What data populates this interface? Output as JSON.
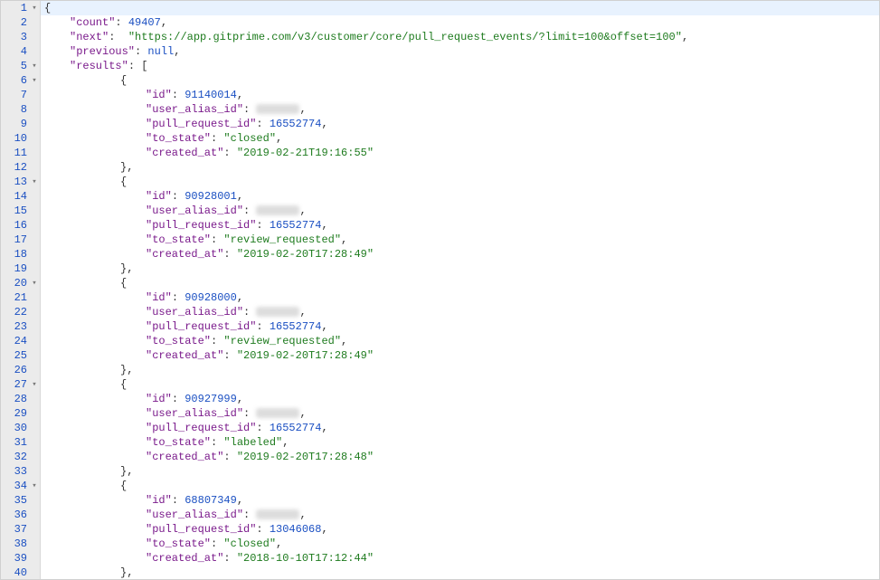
{
  "json": {
    "count": 49407,
    "next": "https://app.gitprime.com/v3/customer/core/pull_request_events/?limit=100&offset=100",
    "previous": null,
    "results": [
      {
        "id": 91140014,
        "user_alias_id": "REDACTED",
        "pull_request_id": 16552774,
        "to_state": "closed",
        "created_at": "2019-02-21T19:16:55"
      },
      {
        "id": 90928001,
        "user_alias_id": "REDACTED",
        "pull_request_id": 16552774,
        "to_state": "review_requested",
        "created_at": "2019-02-20T17:28:49"
      },
      {
        "id": 90928000,
        "user_alias_id": "REDACTED",
        "pull_request_id": 16552774,
        "to_state": "review_requested",
        "created_at": "2019-02-20T17:28:49"
      },
      {
        "id": 90927999,
        "user_alias_id": "REDACTED",
        "pull_request_id": 16552774,
        "to_state": "labeled",
        "created_at": "2019-02-20T17:28:48"
      },
      {
        "id": 68807349,
        "user_alias_id": "REDACTED",
        "pull_request_id": 13046068,
        "to_state": "closed",
        "created_at": "2018-10-10T17:12:44"
      }
    ]
  },
  "labels": {
    "count": "count",
    "next": "next",
    "previous": "previous",
    "results": "results",
    "id": "id",
    "user_alias_id": "user_alias_id",
    "pull_request_id": "pull_request_id",
    "to_state": "to_state",
    "created_at": "created_at",
    "null": "null"
  },
  "fold_glyph": "▾",
  "total_lines": 40
}
